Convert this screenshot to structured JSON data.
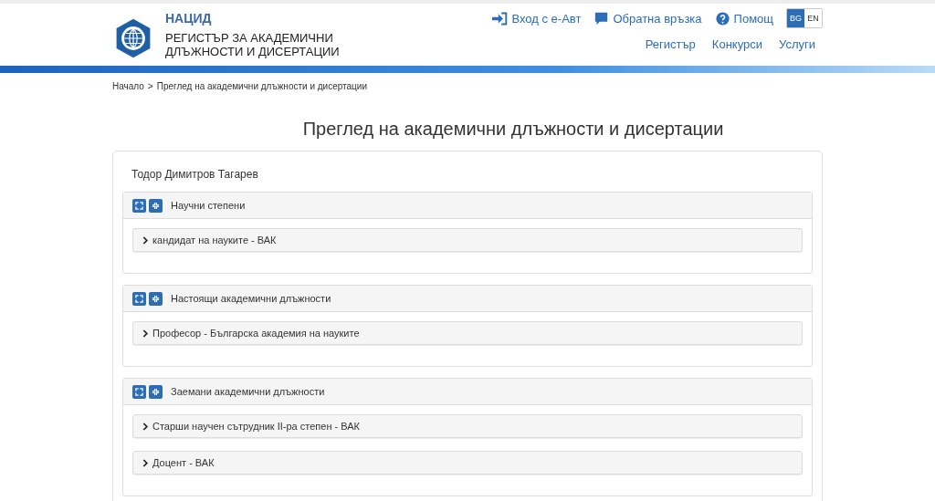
{
  "header": {
    "org": "НАЦИД",
    "title_lines": [
      "РЕГИСТЪР ЗА АКАДЕМИЧНИ",
      "ДЛЪЖНОСТИ И ДИСЕРТАЦИИ"
    ],
    "top_links": [
      {
        "kind": "login",
        "label": "Вход с е-Авт"
      },
      {
        "kind": "feedback",
        "label": "Обратна връзка"
      },
      {
        "kind": "help",
        "label": "Помощ"
      }
    ],
    "languages": [
      {
        "label": "BG",
        "selected": true
      },
      {
        "label": "EN",
        "selected": false
      }
    ],
    "nav": [
      "Регистър",
      "Конкурси",
      "Услуги"
    ]
  },
  "breadcrumb": [
    "Начало",
    "Преглед на академични длъжности и дисертации"
  ],
  "breadcrumb_separator": ">",
  "page_title": "Преглед на академични длъжности и дисертации",
  "person": "Тодор Димитров Тагарев",
  "sections": [
    {
      "title": "Научни степени",
      "items": [
        {
          "label": "кандидат на науките - ВАК",
          "expanded": false
        }
      ]
    },
    {
      "title": "Настоящи академични длъжности",
      "items": [
        {
          "label": "Професор - Българска академия на науките",
          "expanded": false
        }
      ]
    },
    {
      "title": "Заемани академични длъжности",
      "items": [
        {
          "label": "Старши научен сътрудник II-ра степен - ВАК",
          "expanded": false
        },
        {
          "label": "Доцент - ВАК",
          "expanded": false
        }
      ]
    }
  ]
}
